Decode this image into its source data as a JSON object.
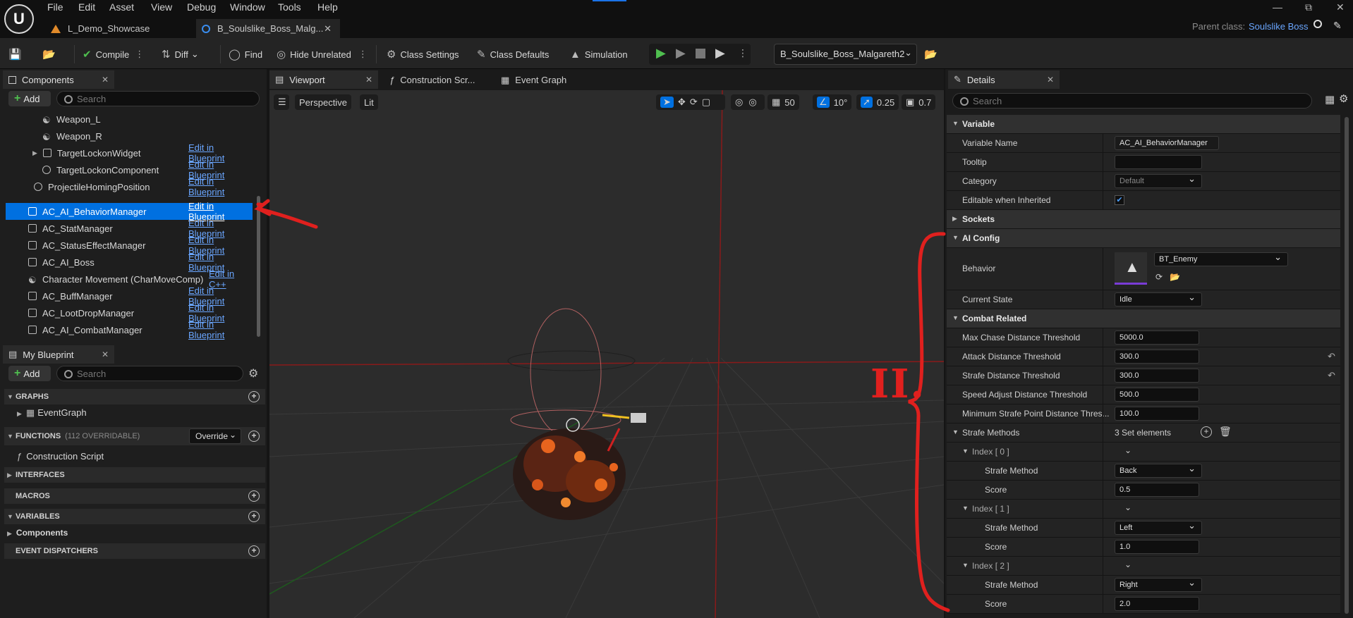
{
  "menu": [
    "File",
    "Edit",
    "Asset",
    "View",
    "Debug",
    "Window",
    "Tools",
    "Help"
  ],
  "tabs": [
    {
      "label": "L_Demo_Showcase"
    },
    {
      "label": "B_Soulslike_Boss_Malg..."
    }
  ],
  "parent_class": {
    "label": "Parent class:",
    "value": "Soulslike Boss"
  },
  "toolbar": {
    "compile": "Compile",
    "diff": "Diff",
    "find": "Find",
    "hide_unrelated": "Hide Unrelated",
    "class_settings": "Class Settings",
    "class_defaults": "Class Defaults",
    "simulation": "Simulation",
    "blueprint_selector": "B_Soulslike_Boss_Malgareth2"
  },
  "components": {
    "tab": "Components",
    "add": "Add",
    "search_placeholder": "Search",
    "rows": [
      {
        "name": "Weapon_L",
        "edit": ""
      },
      {
        "name": "Weapon_R",
        "edit": ""
      },
      {
        "name": "TargetLockonWidget",
        "edit": "Edit in Blueprint"
      },
      {
        "name": "TargetLockonComponent",
        "edit": "Edit in Blueprint"
      },
      {
        "name": "ProjectileHomingPosition",
        "edit": "Edit in Blueprint"
      },
      {
        "name": "AC_AI_BehaviorManager",
        "edit": "Edit in Blueprint"
      },
      {
        "name": "AC_StatManager",
        "edit": "Edit in Blueprint"
      },
      {
        "name": "AC_StatusEffectManager",
        "edit": "Edit in Blueprint"
      },
      {
        "name": "AC_AI_Boss",
        "edit": "Edit in Blueprint"
      },
      {
        "name": "Character Movement (CharMoveComp)",
        "edit": "Edit in C++"
      },
      {
        "name": "AC_BuffManager",
        "edit": "Edit in Blueprint"
      },
      {
        "name": "AC_LootDropManager",
        "edit": "Edit in Blueprint"
      },
      {
        "name": "AC_AI_CombatManager",
        "edit": "Edit in Blueprint"
      }
    ]
  },
  "my_blueprint": {
    "tab": "My Blueprint",
    "add": "Add",
    "search_placeholder": "Search",
    "graphs": "GRAPHS",
    "event_graph": "EventGraph",
    "functions": "FUNCTIONS",
    "functions_count": "(112 OVERRIDABLE)",
    "override": "Override",
    "construction_script": "Construction Script",
    "interfaces": "INTERFACES",
    "macros": "MACROS",
    "variables": "VARIABLES",
    "components": "Components",
    "event_dispatchers": "EVENT DISPATCHERS"
  },
  "editor_tabs": {
    "viewport": "Viewport",
    "construction": "Construction Scr...",
    "event_graph": "Event Graph"
  },
  "viewport": {
    "perspective": "Perspective",
    "lit": "Lit",
    "grid": "50",
    "rotation": "10°",
    "scale": "0.25",
    "camera_speed": "0.7"
  },
  "details": {
    "tab": "Details",
    "search_placeholder": "Search",
    "variable_section": "Variable",
    "variable_name_label": "Variable Name",
    "variable_name": "AC_AI_BehaviorManager",
    "tooltip_label": "Tooltip",
    "tooltip": "",
    "category_label": "Category",
    "category": "Default",
    "editable_label": "Editable when Inherited",
    "sockets": "Sockets",
    "ai_config": "AI Config",
    "behavior_label": "Behavior",
    "behavior": "BT_Enemy",
    "current_state_label": "Current State",
    "current_state": "Idle",
    "combat_related": "Combat Related",
    "max_chase_label": "Max Chase Distance Threshold",
    "max_chase": "5000.0",
    "attack_dist_label": "Attack Distance Threshold",
    "attack_dist": "300.0",
    "strafe_dist_label": "Strafe Distance Threshold",
    "strafe_dist": "300.0",
    "speed_adjust_label": "Speed Adjust Distance Threshold",
    "speed_adjust": "500.0",
    "min_strafe_label": "Minimum Strafe Point Distance Thres...",
    "min_strafe": "100.0",
    "strafe_methods_label": "Strafe Methods",
    "strafe_methods_count": "3 Set elements",
    "index0": "Index [ 0 ]",
    "index1": "Index [ 1 ]",
    "index2": "Index [ 2 ]",
    "strafe_method_label": "Strafe Method",
    "score_label": "Score",
    "m0": "Back",
    "s0": "0.5",
    "m1": "Left",
    "s1": "1.0",
    "m2": "Right",
    "s2": "2.0"
  },
  "annotation": {
    "text": "II.",
    "color": "#e0201e"
  }
}
